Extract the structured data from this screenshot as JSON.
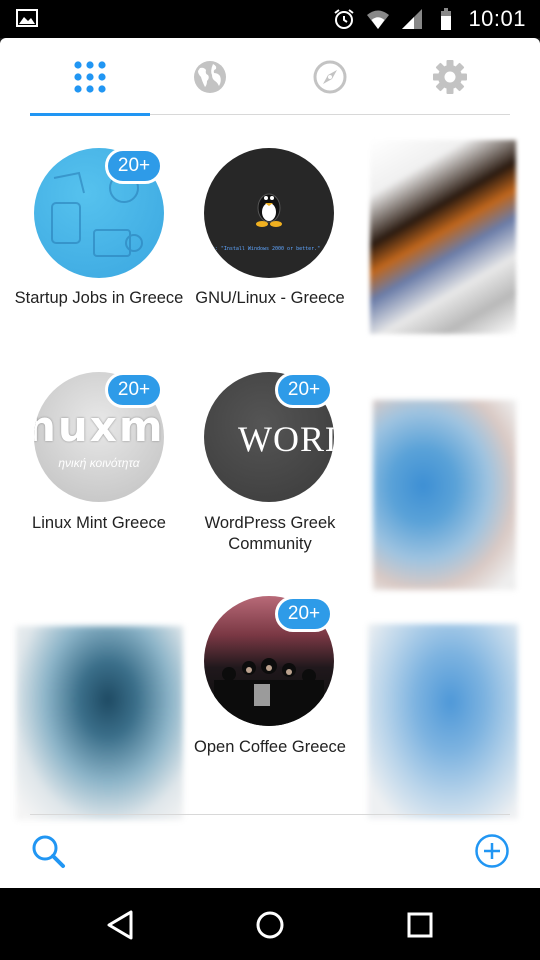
{
  "status_bar": {
    "time": "10:01",
    "icons": [
      "image-notification-icon",
      "alarm-icon",
      "wifi-icon",
      "signal-icon",
      "battery-icon"
    ]
  },
  "tabs": [
    {
      "icon": "grid-icon",
      "active": true
    },
    {
      "icon": "globe-icon",
      "active": false
    },
    {
      "icon": "compass-icon",
      "active": false
    },
    {
      "icon": "gear-icon",
      "active": false
    }
  ],
  "communities": [
    {
      "name": "Startup Jobs in Greece",
      "badge": "20+"
    },
    {
      "name": "GNU/Linux - Greece",
      "badge": "",
      "avatar_caption": "ice: \"Install Windows 2000 or better.\" - n"
    },
    {
      "name": "Linux Mint Greece",
      "badge": "20+",
      "avatar_text": "nuxmin",
      "avatar_subtext": "ηνική κοινότητα"
    },
    {
      "name": "WordPress Greek Community",
      "badge": "20+",
      "avatar_text": "WORD"
    },
    {
      "name": "Open Coffee Greece",
      "badge": "20+"
    }
  ],
  "bottom_bar": {
    "search_icon": "search-icon",
    "add_icon": "add-circle-icon"
  },
  "colors": {
    "accent": "#2196f3",
    "badge": "#2e9be8"
  }
}
